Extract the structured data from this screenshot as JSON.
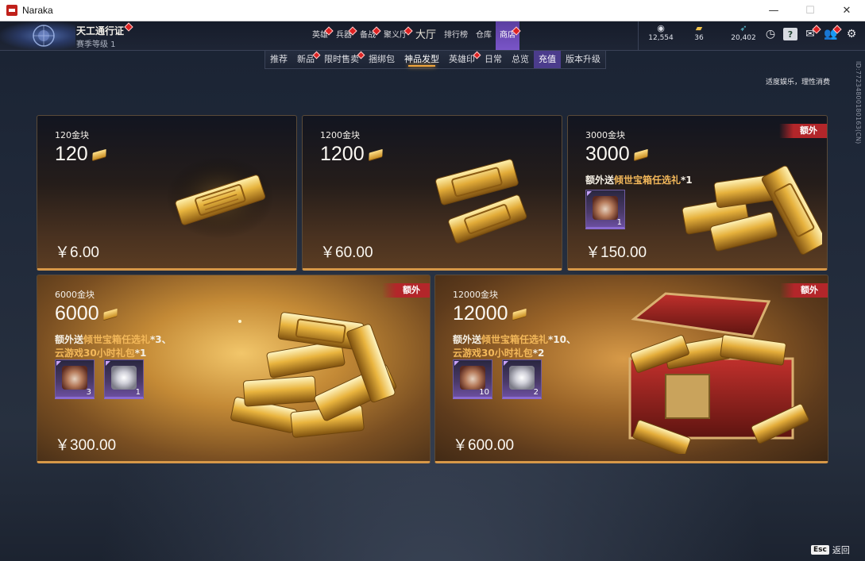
{
  "window": {
    "title": "Naraka",
    "controls": [
      "—",
      "☐",
      "✕"
    ]
  },
  "pass": {
    "title": "天工通行证",
    "level": "赛季等级 1"
  },
  "main_nav": [
    {
      "label": "英雄",
      "dot": true
    },
    {
      "label": "兵器",
      "dot": true
    },
    {
      "label": "备战",
      "dot": true
    },
    {
      "label": "聚义厅",
      "dot": true
    },
    {
      "label": "大厅",
      "big": true
    },
    {
      "label": "排行榜"
    },
    {
      "label": "仓库"
    },
    {
      "label": "商店",
      "dot": true,
      "active": true
    }
  ],
  "currencies": [
    {
      "icon": "eye-coin-icon",
      "glyph": "◉",
      "value": "12,554"
    },
    {
      "icon": "gold-bar-icon",
      "glyph": "▰",
      "value": "36"
    },
    {
      "icon": "feather-icon",
      "glyph": "➶",
      "value": "20,402"
    }
  ],
  "sub_nav": [
    {
      "label": "推荐"
    },
    {
      "label": "新品",
      "dot": true
    },
    {
      "label": "限时售卖",
      "dot": true
    },
    {
      "label": "捆绑包"
    },
    {
      "label": "神品发型",
      "hot": true
    },
    {
      "label": "英雄印",
      "dot": true
    },
    {
      "label": "日常"
    },
    {
      "label": "总览"
    },
    {
      "label": "充值",
      "active": true
    },
    {
      "label": "版本升级"
    }
  ],
  "moderation_text": "适度娱乐，理性消费",
  "vertical_id": "ID:77234800180163(CN)",
  "extra_badge": "额外",
  "cards": [
    {
      "label": "120金块",
      "amount": "120",
      "price": "￥6.00"
    },
    {
      "label": "1200金块",
      "amount": "1200",
      "price": "￥60.00"
    },
    {
      "label": "3000金块",
      "amount": "3000",
      "price": "￥150.00",
      "bonus_prefix": "额外送",
      "bonus_hl": "倾世宝箱任选礼",
      "bonus_suffix": "*1",
      "items": [
        {
          "art": "chest-icon",
          "count": "1"
        }
      ]
    },
    {
      "label": "6000金块",
      "amount": "6000",
      "price": "￥300.00",
      "bonus_prefix": "额外送",
      "bonus_hl": "倾世宝箱任选礼",
      "bonus_suffix": "*3、",
      "bonus_line2_hl": "云游戏30小时礼包",
      "bonus_line2_suffix": "*1",
      "items": [
        {
          "art": "chest-icon",
          "count": "3"
        },
        {
          "art": "silver-pack-icon",
          "count": "1"
        }
      ]
    },
    {
      "label": "12000金块",
      "amount": "12000",
      "price": "￥600.00",
      "bonus_prefix": "额外送",
      "bonus_hl": "倾世宝箱任选礼",
      "bonus_suffix": "*10、",
      "bonus_line2_hl": "云游戏30小时礼包",
      "bonus_line2_suffix": "*2",
      "items": [
        {
          "art": "chest-icon",
          "count": "10"
        },
        {
          "art": "silver-pack-icon",
          "count": "2"
        }
      ]
    }
  ],
  "esc": {
    "key": "Esc",
    "label": "返回"
  }
}
